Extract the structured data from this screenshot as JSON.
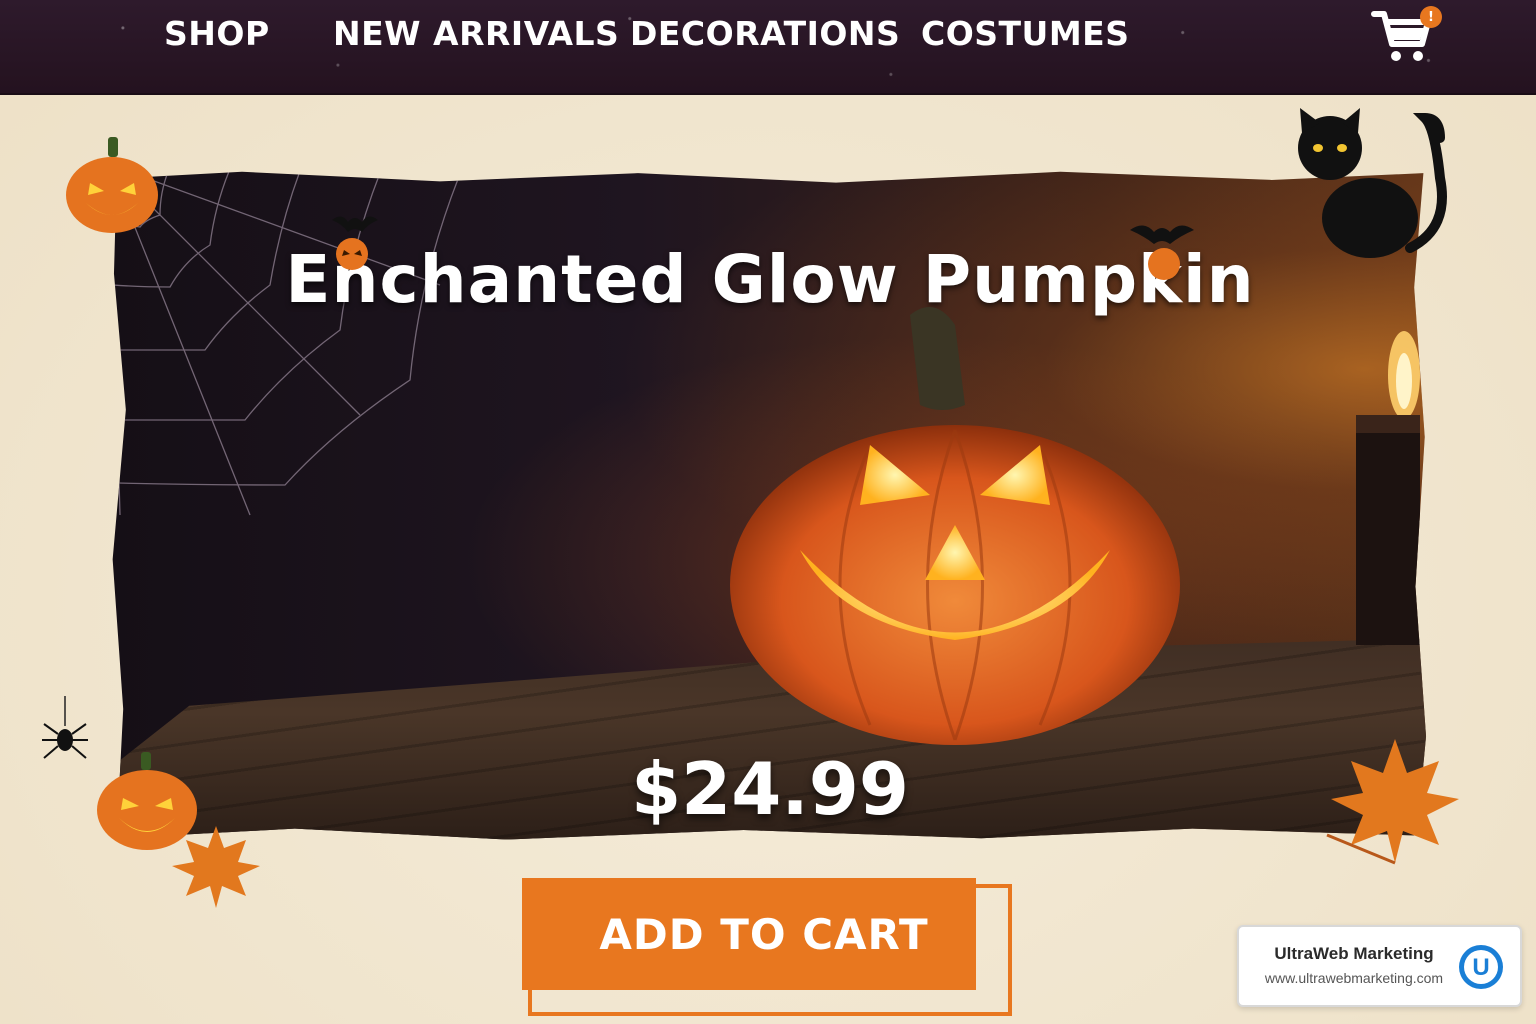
{
  "nav": {
    "items": [
      {
        "label": "SHOP"
      },
      {
        "label": "NEW ARRIVALS"
      },
      {
        "label": "DECORATIONS"
      },
      {
        "label": "COSTUMES"
      }
    ],
    "cart_badge": "!",
    "cart_icon": "shopping-cart-icon"
  },
  "product": {
    "title": "Enchanted Glow Pumpkin",
    "price": "$24.99"
  },
  "cta": {
    "label": "ADD TO CART"
  },
  "watermark": {
    "name": "UltraWeb Marketing",
    "url": "www.ultrawebmarketing.com",
    "logo_letter": "U"
  },
  "colors": {
    "nav_bg": "#2a1728",
    "accent_orange": "#e8771f",
    "page_bg": "#f1e6d0"
  },
  "decorations": [
    "jack-o-lantern-icon",
    "spider-web-icon",
    "black-cat-icon",
    "bat-icon",
    "spider-icon",
    "maple-leaf-icon",
    "candle-icon"
  ]
}
